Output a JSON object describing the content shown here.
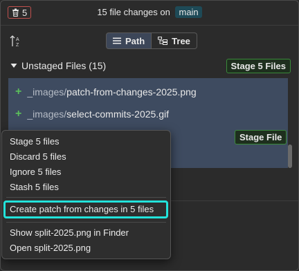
{
  "header": {
    "trash_count": "5",
    "title_prefix": "15 file changes on",
    "branch": "main"
  },
  "view_toggle": {
    "path_label": "Path",
    "tree_label": "Tree",
    "active": "Path"
  },
  "unstaged": {
    "header": "Unstaged Files (15)",
    "stage_all_label": "Stage 5 Files",
    "stage_file_label": "Stage File",
    "files": [
      {
        "dir": "_images/",
        "name": "patch-from-changes-2025.png"
      },
      {
        "dir": "_images/",
        "name": "select-commits-2025.gif"
      }
    ]
  },
  "context_menu": {
    "group1": [
      "Stage 5 files",
      "Discard 5 files",
      "Ignore 5 files",
      "Stash 5 files"
    ],
    "highlighted": "Create patch from changes in 5 files",
    "group3": [
      "Show split-2025.png in Finder",
      "Open split-2025.png"
    ]
  },
  "colors": {
    "accent_highlight": "#22e3db",
    "stage_border": "#3a8a3a",
    "trash_border": "#c0504d",
    "selection": "#3e4b60"
  }
}
